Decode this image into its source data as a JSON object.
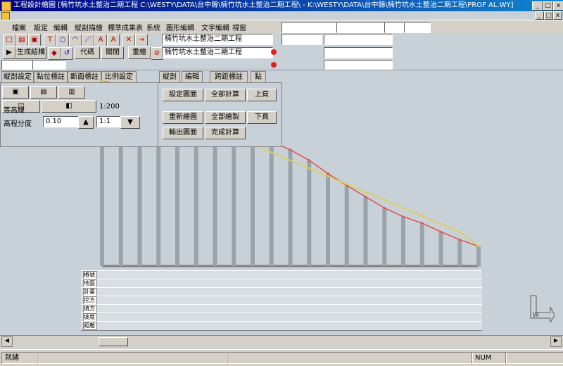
{
  "window": {
    "title": "工程設計繪圖 [楠竹坑水土整治二期工程 C:\\WESTY\\DATA\\台中縣\\楠竹坑水土整治二期工程\\ - K:\\WESTY\\DATA\\台中縣\\楠竹坑水土整治二期工程\\PROF AL.WY]",
    "min_label": "_",
    "max_label": "□",
    "close_label": "x"
  },
  "child_window": {
    "min_label": "_",
    "max_label": "□",
    "close_label": "x"
  },
  "menu": {
    "items": [
      "檔案",
      "設定",
      "編輯",
      "縱剖描繪",
      "標準成果表",
      "系統",
      "圖形編輯",
      "文字編輯",
      "視窗"
    ]
  },
  "toolbar": {
    "project_name": "楠竹坑水土整治二期工程",
    "generate_label": "生成結構",
    "code_label": "代碼",
    "close_label": "關閉",
    "redraw_label": "重繪"
  },
  "tabs": [
    "縱剖設定",
    "點位標註",
    "斷面標註",
    "比例設定"
  ],
  "right_tabs": [
    "縱剖",
    "編輯",
    "跨距標註",
    "點"
  ],
  "panel": {
    "scale_label": "比例尺",
    "scale_value": "1:200",
    "unit_label": "高程分度",
    "step_value": "0.10",
    "grid_label": "等高線",
    "ratio_value": "1:1",
    "btn_setting": "設定圖面",
    "btn_all_calc": "全部計算",
    "btn_up": "上頁",
    "btn_draw": "重新繪圖",
    "btn_all_draw": "全部繪製",
    "btn_down": "下頁",
    "btn_output": "輸出圖面",
    "btn_complete": "完成計算"
  },
  "profile_table": {
    "rows": [
      "樁號",
      "地面高",
      "計畫高",
      "挖方",
      "填方",
      "坡度",
      "距離"
    ]
  },
  "statusbar": {
    "ready": "就緒",
    "coord": "",
    "mode": "NUM"
  },
  "chart_data": {
    "type": "line",
    "series": [
      {
        "values": [
          0,
          6,
          14,
          24,
          38,
          50,
          60,
          70,
          80,
          92,
          104,
          120,
          140,
          158,
          175,
          192,
          205,
          215,
          228,
          240,
          250
        ]
      },
      {
        "values": [
          0,
          12,
          24,
          36,
          48,
          60,
          72,
          84,
          96,
          108,
          120,
          132,
          144,
          156,
          168,
          180,
          192,
          204,
          216,
          228,
          250
        ]
      }
    ],
    "colors": [
      "#e05050",
      "#e0d040"
    ]
  }
}
